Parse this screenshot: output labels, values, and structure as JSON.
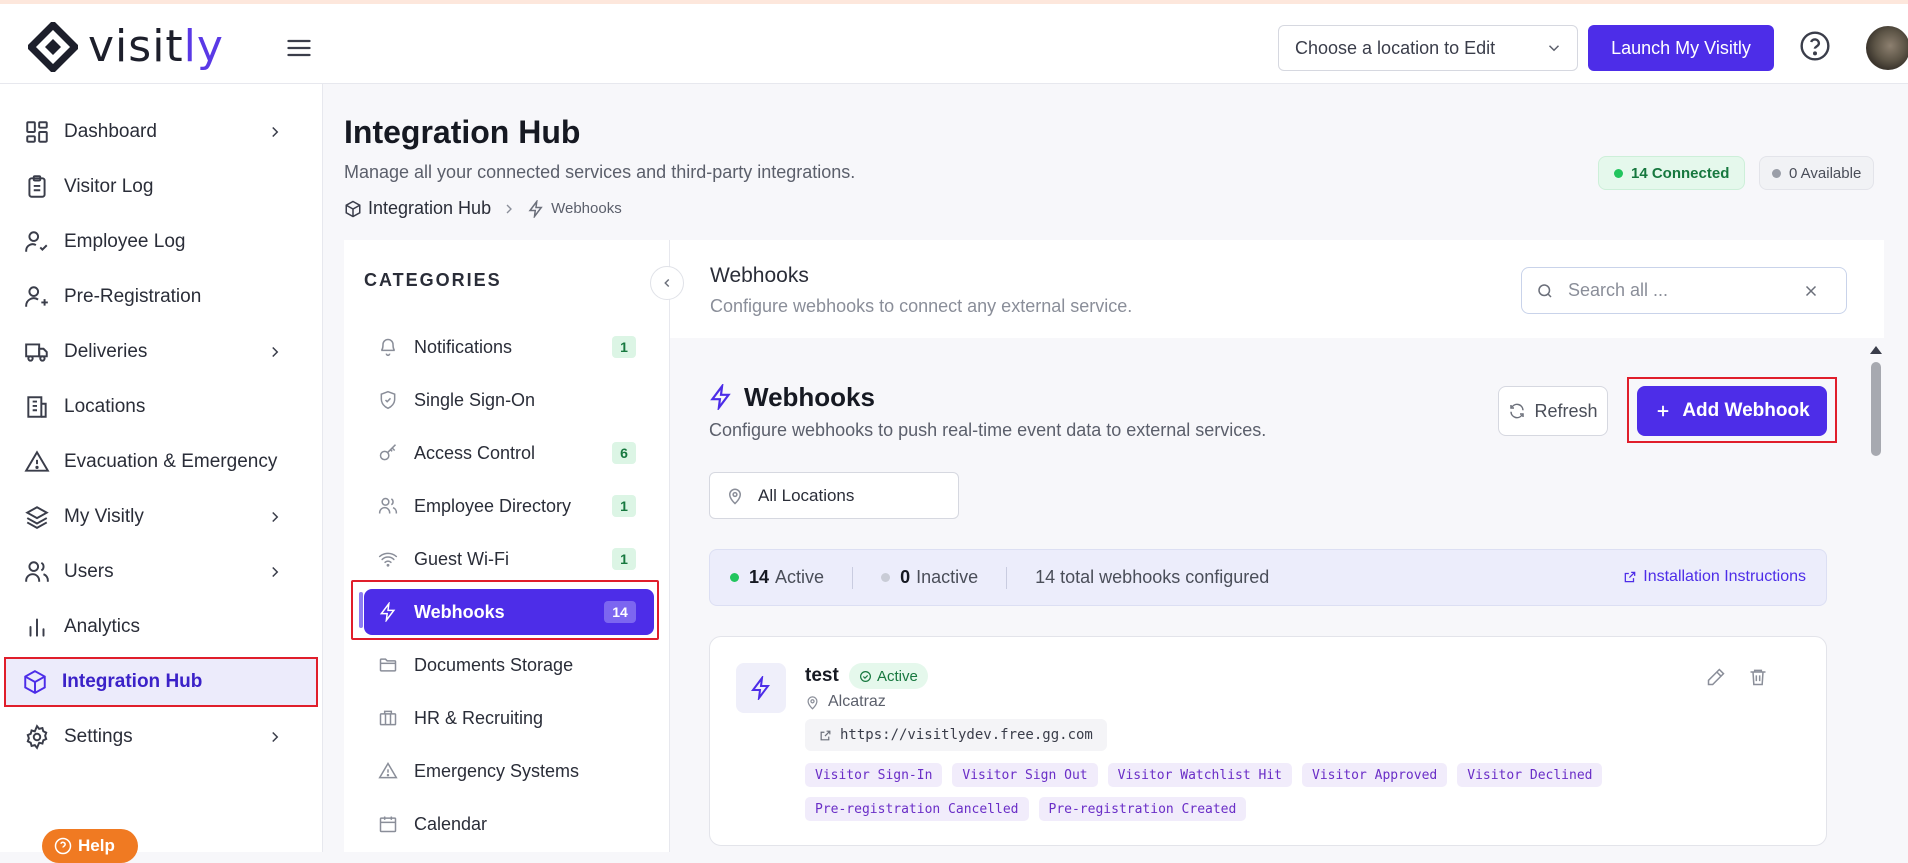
{
  "header": {
    "logo_text_main": "visit",
    "logo_text_accent": "ly",
    "location_select": "Choose a location to Edit",
    "launch_button": "Launch My Visitly"
  },
  "sidebar": {
    "items": [
      {
        "label": "Dashboard",
        "icon": "dashboard-icon",
        "has_arrow": true
      },
      {
        "label": "Visitor Log",
        "icon": "clipboard-icon",
        "has_arrow": false
      },
      {
        "label": "Employee Log",
        "icon": "user-check-icon",
        "has_arrow": false
      },
      {
        "label": "Pre-Registration",
        "icon": "user-plus-icon",
        "has_arrow": false
      },
      {
        "label": "Deliveries",
        "icon": "truck-icon",
        "has_arrow": true
      },
      {
        "label": "Locations",
        "icon": "building-icon",
        "has_arrow": false
      },
      {
        "label": "Evacuation & Emergency",
        "icon": "warning-icon",
        "has_arrow": false
      },
      {
        "label": "My Visitly",
        "icon": "layers-icon",
        "has_arrow": true
      },
      {
        "label": "Users",
        "icon": "users-icon",
        "has_arrow": true
      },
      {
        "label": "Analytics",
        "icon": "bar-chart-icon",
        "has_arrow": false
      },
      {
        "label": "Integration Hub",
        "icon": "cube-icon",
        "has_arrow": false,
        "active": true
      },
      {
        "label": "Settings",
        "icon": "gear-icon",
        "has_arrow": true
      }
    ],
    "help_label": "Help"
  },
  "page": {
    "title": "Integration Hub",
    "subtitle": "Manage all your connected services and third-party integrations.",
    "breadcrumb_root": "Integration Hub",
    "breadcrumb_current": "Webhooks",
    "connected_badge": "14 Connected",
    "available_badge": "0 Available"
  },
  "categories": {
    "title": "CATEGORIES",
    "items": [
      {
        "label": "Notifications",
        "icon": "bell-icon",
        "count": "1"
      },
      {
        "label": "Single Sign-On",
        "icon": "shield-check-icon",
        "count": ""
      },
      {
        "label": "Access Control",
        "icon": "key-icon",
        "count": "6"
      },
      {
        "label": "Employee Directory",
        "icon": "users-icon",
        "count": "1"
      },
      {
        "label": "Guest Wi-Fi",
        "icon": "wifi-icon",
        "count": "1"
      },
      {
        "label": "Webhooks",
        "icon": "lightning-icon",
        "count": "14",
        "active": true
      },
      {
        "label": "Documents Storage",
        "icon": "folder-icon",
        "count": ""
      },
      {
        "label": "HR & Recruiting",
        "icon": "briefcase-icon",
        "count": ""
      },
      {
        "label": "Emergency Systems",
        "icon": "warning-icon",
        "count": ""
      },
      {
        "label": "Calendar",
        "icon": "calendar-icon",
        "count": ""
      }
    ]
  },
  "content": {
    "header_title": "Webhooks",
    "header_sub": "Configure webhooks to connect any external service.",
    "search_placeholder": "Search all ...",
    "section_title": "Webhooks",
    "section_sub": "Configure webhooks to push real-time event data to external services.",
    "refresh_label": "Refresh",
    "add_label": "Add Webhook",
    "location_filter": "All Locations",
    "stats": {
      "active_count": "14",
      "active_label": "Active",
      "inactive_count": "0",
      "inactive_label": "Inactive",
      "total_text": "14 total webhooks configured",
      "install_link": "Installation Instructions"
    },
    "webhook": {
      "name": "test",
      "status": "Active",
      "location": "Alcatraz",
      "url": "https://visitlydev.free.gg.com",
      "events": [
        "Visitor Sign-In",
        "Visitor Sign Out",
        "Visitor Watchlist Hit",
        "Visitor Approved",
        "Visitor Declined",
        "Pre-registration Cancelled",
        "Pre-registration Created"
      ]
    }
  },
  "colors": {
    "brand": "#4d2de8",
    "success": "#17783f",
    "highlight": "#e01e2b"
  }
}
